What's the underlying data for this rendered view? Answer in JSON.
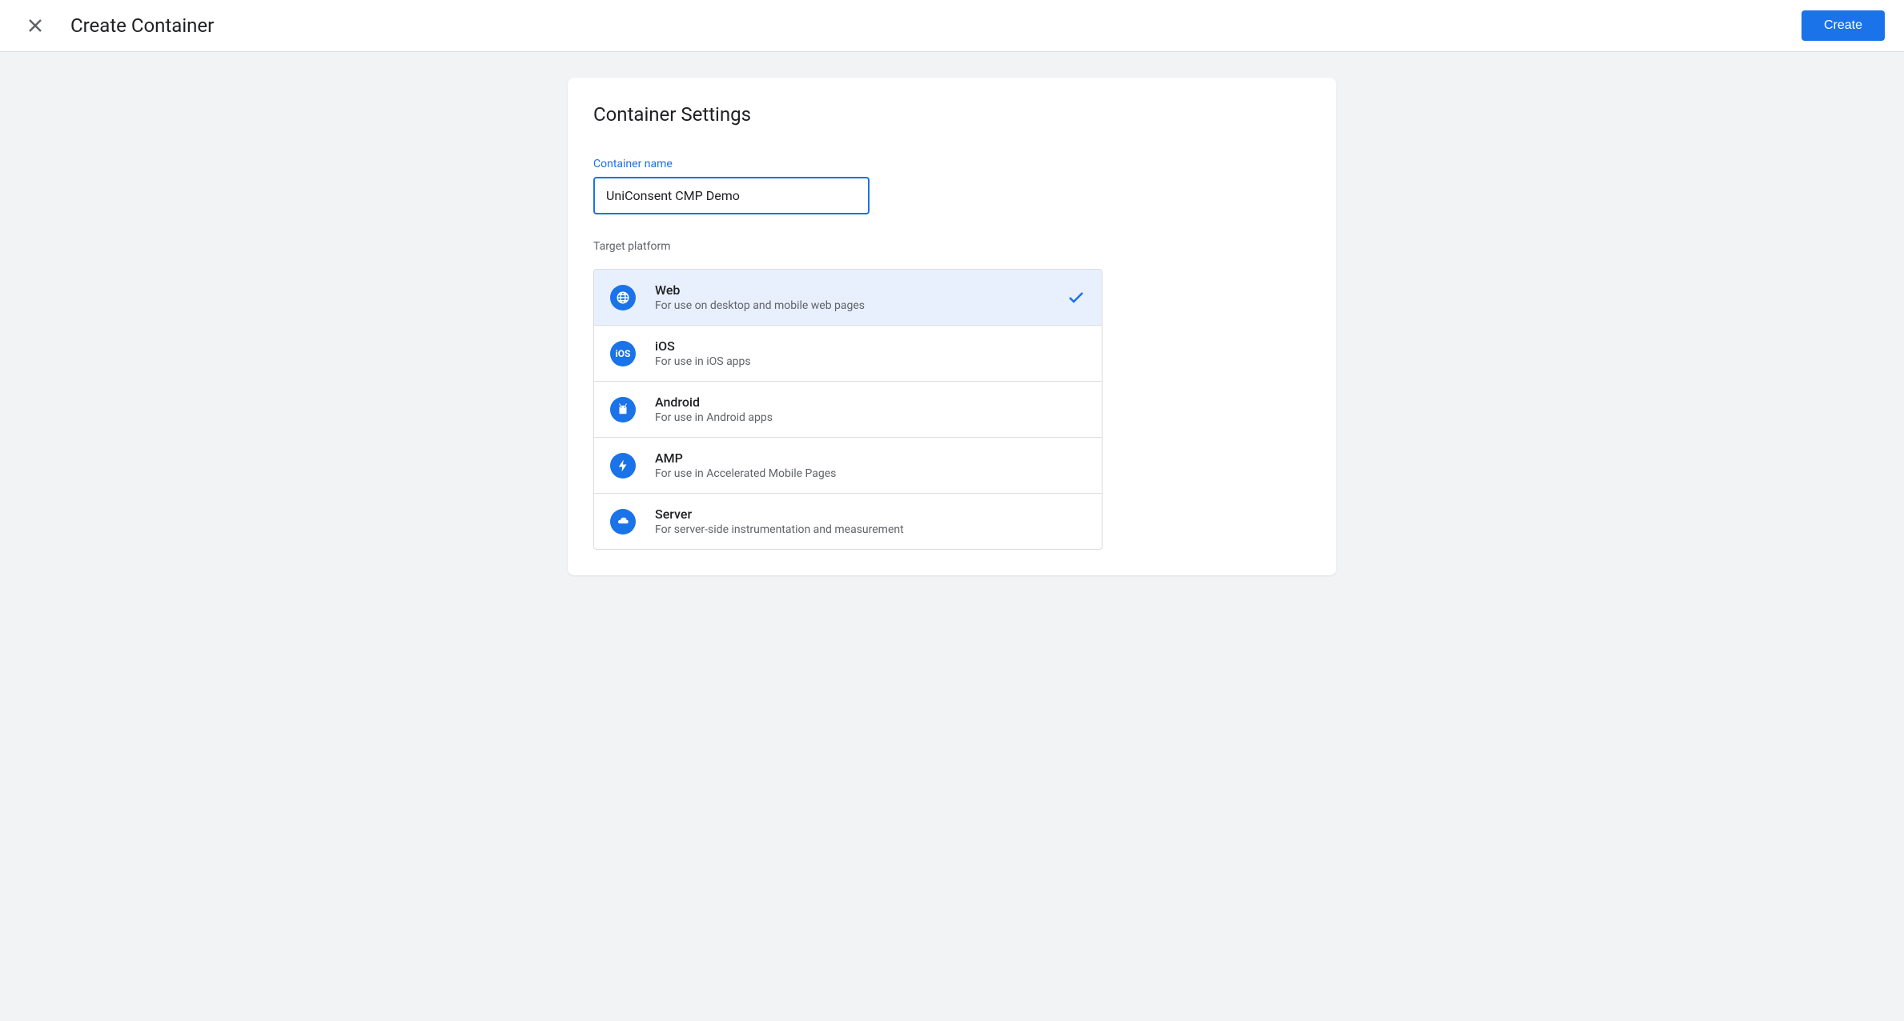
{
  "header": {
    "title": "Create Container",
    "create_button": "Create"
  },
  "card": {
    "title": "Container Settings",
    "container_name_label": "Container name",
    "container_name_value": "UniConsent CMP Demo",
    "target_platform_label": "Target platform"
  },
  "platforms": [
    {
      "name": "Web",
      "desc": "For use on desktop and mobile web pages",
      "icon": "globe-icon",
      "selected": true
    },
    {
      "name": "iOS",
      "desc": "For use in iOS apps",
      "icon": "ios-icon",
      "selected": false
    },
    {
      "name": "Android",
      "desc": "For use in Android apps",
      "icon": "android-icon",
      "selected": false
    },
    {
      "name": "AMP",
      "desc": "For use in Accelerated Mobile Pages",
      "icon": "bolt-icon",
      "selected": false
    },
    {
      "name": "Server",
      "desc": "For server-side instrumentation and measurement",
      "icon": "cloud-icon",
      "selected": false
    }
  ]
}
